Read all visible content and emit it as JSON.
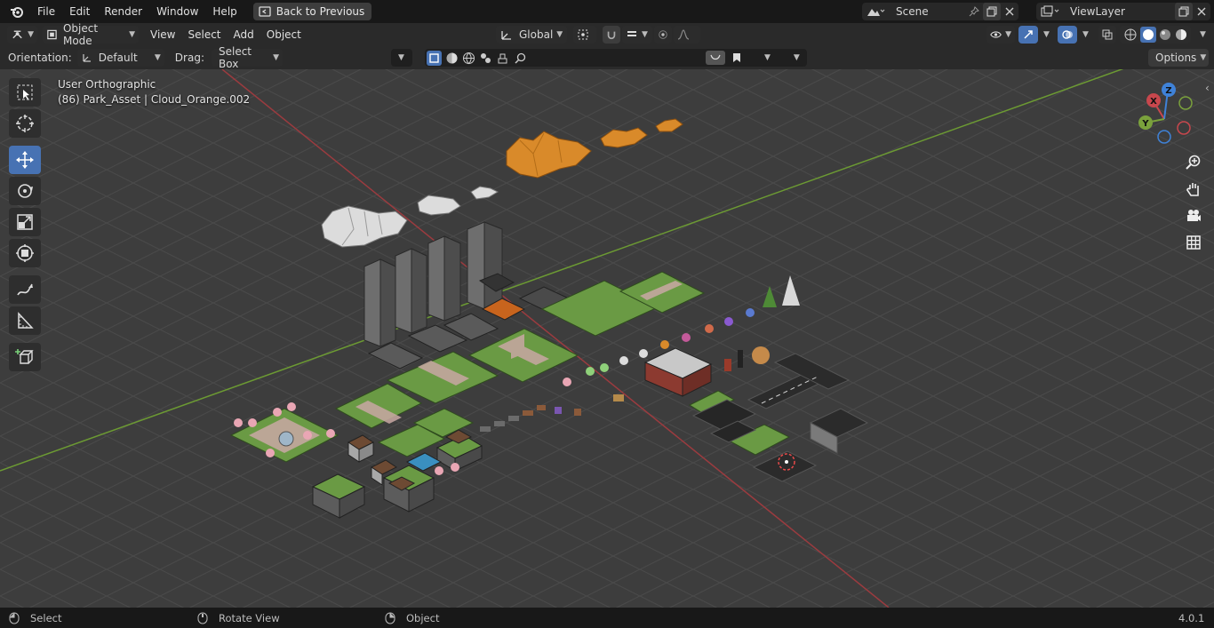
{
  "topbar": {
    "menus": [
      "File",
      "Edit",
      "Render",
      "Window",
      "Help"
    ],
    "back_button": "Back to Previous",
    "scene": "Scene",
    "view_layer": "ViewLayer"
  },
  "viewport_header": {
    "mode": "Object Mode",
    "menus": [
      "View",
      "Select",
      "Add",
      "Object"
    ],
    "transform_orientation": "Global"
  },
  "tool_settings": {
    "orientation_label": "Orientation:",
    "orientation_value": "Default",
    "drag_label": "Drag:",
    "drag_value": "Select Box",
    "search_placeholder": "",
    "options": "Options"
  },
  "viewport": {
    "view_name": "User Orthographic",
    "context": "(86) Park_Asset | Cloud_Orange.002",
    "gizmo_axes": [
      "X",
      "Y",
      "Z"
    ]
  },
  "statusbar": {
    "select": "Select",
    "rotate": "Rotate View",
    "object": "Object",
    "version": "4.0.1"
  },
  "colors": {
    "active_tool": "#4772b3",
    "x_axis": "#c8474d",
    "y_axis": "#7aa13c",
    "z_axis": "#3f82d8",
    "grass": "#6a9a44",
    "cloud_orange": "#d98a2a",
    "cloud_white": "#dcdcdc"
  },
  "icons": {
    "toolbar": [
      "select-box-icon",
      "cursor-icon",
      "move-icon",
      "rotate-icon",
      "scale-icon",
      "transform-icon",
      "annotate-icon",
      "measure-icon",
      "add-cube-icon"
    ],
    "nav": [
      "zoom-icon",
      "pan-hand-icon",
      "camera-icon",
      "grid-icon"
    ]
  }
}
